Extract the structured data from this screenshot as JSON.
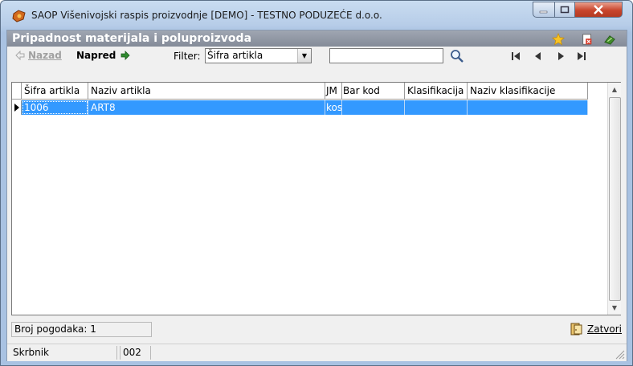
{
  "window": {
    "title": "SAOP  Višenivojski raspis proizvodnje  [DEMO] - TESTNO PODUZEĆE d.o.o.",
    "controls": [
      "minimize",
      "maximize",
      "close"
    ]
  },
  "form": {
    "title": "Pripadnost materijala i poluproizvoda"
  },
  "toolbar": {
    "back_label": "Nazad",
    "back_hotkey": "N",
    "forward_label": "Napred",
    "filter_label": "Filter:",
    "filter_value": "Šifra artikla",
    "search_value": "",
    "icons": [
      "star-icon",
      "delete-document-icon",
      "exit-icon",
      "search-icon",
      "first-record-icon",
      "previous-record-icon",
      "next-record-icon",
      "last-record-icon"
    ]
  },
  "grid": {
    "columns": [
      "Šifra artikla",
      "Naziv artikla",
      "JM",
      "Bar kod",
      "Klasifikacija",
      "Naziv klasifikacije"
    ],
    "rows": [
      [
        "1006",
        "ART8",
        "kos",
        "",
        "",
        ""
      ]
    ]
  },
  "status": {
    "count_text": "Broj pogodaka: 1",
    "close_label": "Zatvori"
  },
  "footer": {
    "user": "Skrbnik",
    "code": "002"
  },
  "colors": {
    "selection": "#3399ff",
    "form_title_bg": "#8c929d",
    "close_button": "#c8452c"
  }
}
